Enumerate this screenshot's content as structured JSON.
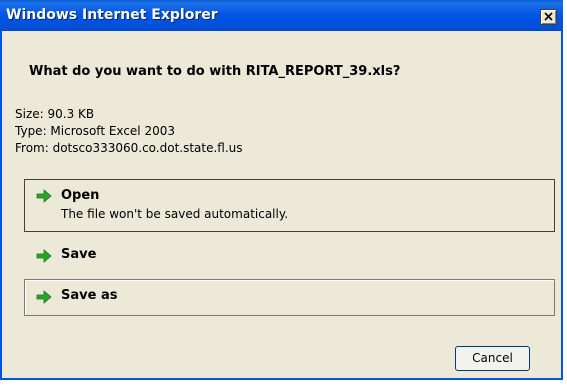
{
  "window": {
    "title": "Windows Internet Explorer",
    "close_icon": "close-x-icon"
  },
  "prompt": {
    "question": "What do you want to do with RITA_REPORT_39.xls?"
  },
  "file_info": {
    "size": "Size: 90.3 KB",
    "type": "Type: Microsoft Excel 2003",
    "from": "From: dotsco333060.co.dot.state.fl.us"
  },
  "options": [
    {
      "label": "Open",
      "description": "The file won't be saved automatically.",
      "icon": "green-arrow-icon"
    },
    {
      "label": "Save",
      "icon": "green-arrow-icon"
    },
    {
      "label": "Save as",
      "icon": "green-arrow-icon"
    }
  ],
  "buttons": {
    "cancel": "Cancel"
  },
  "colors": {
    "titlebar": "#0055e5",
    "dialog_background": "#ece9d8",
    "arrow": "#2aa52a"
  }
}
